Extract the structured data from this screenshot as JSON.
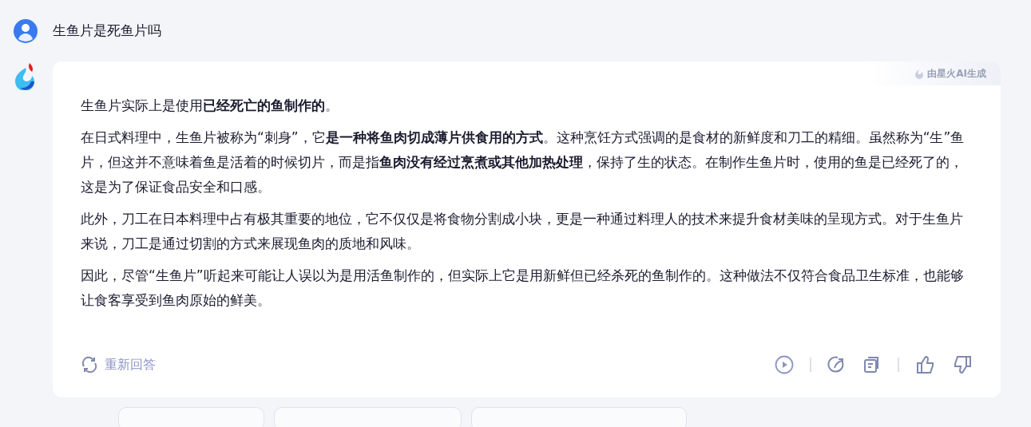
{
  "question": {
    "text": "生鱼片是死鱼片吗"
  },
  "answer": {
    "badge": "由星火AI生成",
    "paragraphs": [
      "生鱼片实际上是使用**已经死亡的鱼制作的**。",
      "在日式料理中，生鱼片被称为“刺身”，它**是一种将鱼肉切成薄片供食用的方式**。这种烹饪方式强调的是食材的新鲜度和刀工的精细。虽然称为“生”鱼片，但这并不意味着鱼是活着的时候切片，而是指**鱼肉没有经过烹煮或其他加热处理**，保持了生的状态。在制作生鱼片时，使用的鱼是已经死了的，这是为了保证食品安全和口感。",
      "此外，刀工在日本料理中占有极其重要的地位，它不仅仅是将食物分割成小块，更是一种通过料理人的技术来提升食材美味的呈现方式。对于生鱼片来说，刀工是通过切割的方式来展现鱼肉的质地和风味。",
      "因此，尽管“生鱼片”听起来可能让人误以为是用活鱼制作的，但实际上它是用新鲜但已经杀死的鱼制作的。这种做法不仅符合食品卫生标准，也能够让食客享受到鱼肉原始的鲜美。"
    ],
    "regenerate": "重新回答"
  }
}
